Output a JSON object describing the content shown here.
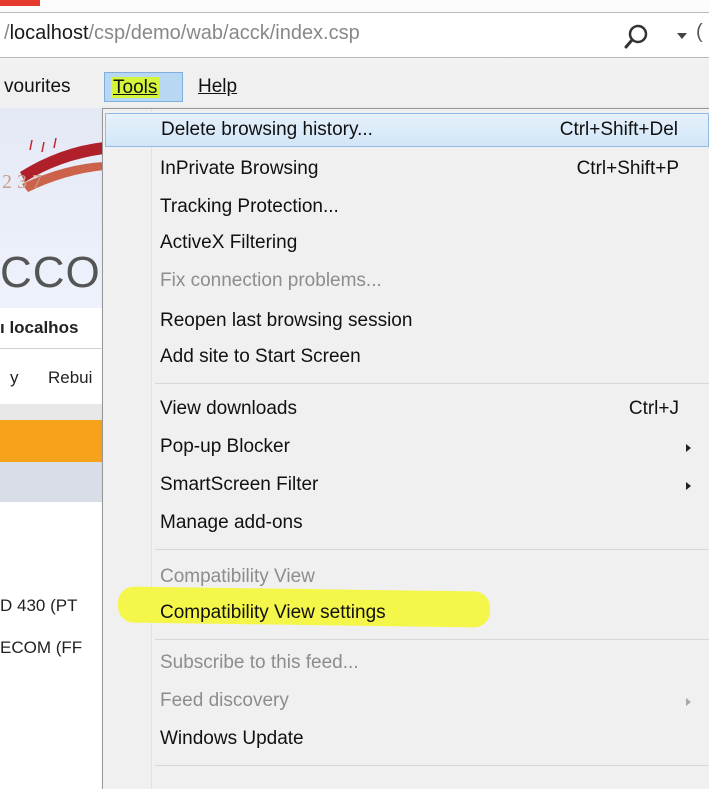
{
  "address_bar": {
    "url_prefix": "/",
    "url_host": "localhost",
    "url_path": "/csp/demo/wab/acck/index.csp",
    "edge_char": "("
  },
  "menubar": {
    "favourites_label": "vourites",
    "tools_label": "Tools",
    "help_label": "Help"
  },
  "page": {
    "logo_digits": "2 3 7",
    "brand_text": "CCO",
    "host_label": "ı localhos",
    "tab_y": "y",
    "tab_rebuild": "Rebui",
    "row_430": "D 430 (PT",
    "row_ecom": "ECOM (FF"
  },
  "menu": {
    "items": [
      {
        "label": "Delete browsing history...",
        "shortcut": "Ctrl+Shift+Del"
      },
      {
        "label": "InPrivate Browsing",
        "shortcut": "Ctrl+Shift+P"
      },
      {
        "label": "Tracking Protection...",
        "shortcut": ""
      },
      {
        "label": "ActiveX Filtering",
        "shortcut": ""
      },
      {
        "label": "Fix connection problems...",
        "shortcut": ""
      },
      {
        "label": "Reopen last browsing session",
        "shortcut": ""
      },
      {
        "label": "Add site to Start Screen",
        "shortcut": ""
      },
      {
        "label": "View downloads",
        "shortcut": "Ctrl+J"
      },
      {
        "label": "Pop-up Blocker",
        "shortcut": ""
      },
      {
        "label": "SmartScreen Filter",
        "shortcut": ""
      },
      {
        "label": "Manage add-ons",
        "shortcut": ""
      },
      {
        "label": "Compatibility View",
        "shortcut": ""
      },
      {
        "label": "Compatibility View settings",
        "shortcut": ""
      },
      {
        "label": "Subscribe to this feed...",
        "shortcut": ""
      },
      {
        "label": "Feed discovery",
        "shortcut": ""
      },
      {
        "label": "Windows Update",
        "shortcut": ""
      }
    ]
  },
  "colors": {
    "highlight": "#f4f74a",
    "tools_highlight": "#d4f53a",
    "orange_bar": "#f7a21b",
    "selection": "#d2e6f8",
    "disabled_text": "#8d8d8d"
  }
}
